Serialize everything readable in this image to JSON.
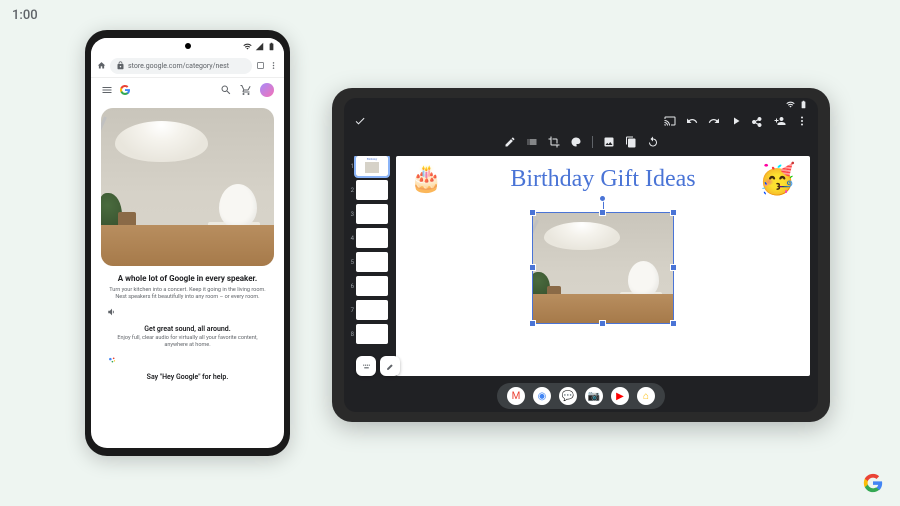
{
  "stage": {
    "clock": "1:00"
  },
  "phone": {
    "url": "store.google.com/category/nest",
    "hero_title": "A whole lot of Google in every speaker.",
    "hero_desc": "Turn your kitchen into a concert. Keep it going in the living room. Nest speakers fit beautifully into any room – or every room.",
    "sub1_title": "Get great sound, all around.",
    "sub1_desc": "Enjoy full, clear audio for virtually all your favorite content, anywhere at home.",
    "sub2_title": "Say \"Hey Google\" for help."
  },
  "tablet": {
    "slide_title": "Birthday Gift Ideas",
    "thumb_count": 8,
    "active_thumb": 1,
    "dock": [
      {
        "name": "gmail",
        "bg": "#ffffff",
        "glyph": "M",
        "color": "#ea4335"
      },
      {
        "name": "chrome",
        "bg": "#ffffff",
        "glyph": "◉",
        "color": "#4285f4"
      },
      {
        "name": "messages",
        "bg": "#ffffff",
        "glyph": "💬",
        "color": "#1a73e8"
      },
      {
        "name": "camera",
        "bg": "#ffffff",
        "glyph": "📷",
        "color": "#333"
      },
      {
        "name": "youtube",
        "bg": "#ffffff",
        "glyph": "▶",
        "color": "#ff0000"
      },
      {
        "name": "home",
        "bg": "#ffffff",
        "glyph": "⌂",
        "color": "#fbbc04"
      }
    ]
  }
}
